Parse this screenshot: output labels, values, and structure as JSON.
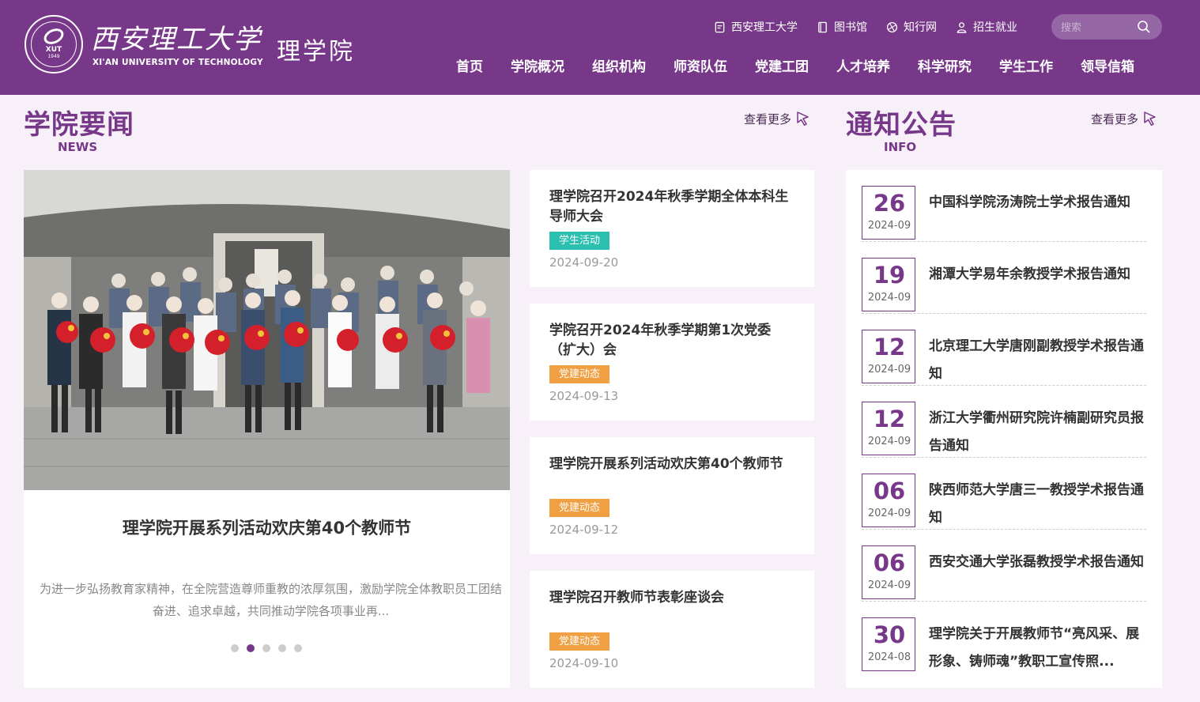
{
  "header": {
    "logo": {
      "seal_text": "XUT",
      "seal_year": "1949",
      "university_name": "西安理工大学",
      "university_en": "XI'AN UNIVERSITY OF TECHNOLOGY",
      "college_name": "理学院"
    },
    "toplinks": [
      {
        "label": "西安理工大学",
        "icon": "document-icon"
      },
      {
        "label": "图书馆",
        "icon": "book-icon"
      },
      {
        "label": "知行网",
        "icon": "globe-icon"
      },
      {
        "label": "招生就业",
        "icon": "user-icon"
      }
    ],
    "search": {
      "placeholder": "搜索"
    },
    "nav": [
      "首页",
      "学院概况",
      "组织机构",
      "师资队伍",
      "党建工团",
      "人才培养",
      "科学研究",
      "学生工作",
      "领导信箱"
    ]
  },
  "news_section": {
    "title": "学院要闻",
    "subtitle": "NEWS",
    "more_label": "查看更多"
  },
  "notice_section": {
    "title": "通知公告",
    "subtitle": "INFO",
    "more_label": "查看更多"
  },
  "featured": {
    "title": "理学院开展系列活动欢庆第40个教师节",
    "summary": "为进一步弘扬教育家精神，在全院营造尊师重教的浓厚氛围，激励学院全体教职员工团结奋进、追求卓越，共同推动学院各项事业再...",
    "carousel": {
      "count": 5,
      "active": 2
    }
  },
  "news": [
    {
      "title": "理学院召开2024年秋季学期全体本科生导师大会",
      "tag": "学生活动",
      "date": "2024-09-20"
    },
    {
      "title": "学院召开2024年秋季学期第1次党委（扩大）会",
      "tag": "党建动态",
      "date": "2024-09-13"
    },
    {
      "title": "理学院开展系列活动欢庆第40个教师节",
      "tag": "党建动态",
      "date": "2024-09-12"
    },
    {
      "title": "理学院召开教师节表彰座谈会",
      "tag": "党建动态",
      "date": "2024-09-10"
    }
  ],
  "notices": [
    {
      "day": "26",
      "ym": "2024-09",
      "title": "中国科学院汤涛院士学术报告通知"
    },
    {
      "day": "19",
      "ym": "2024-09",
      "title": "湘潭大学易年余教授学术报告通知"
    },
    {
      "day": "12",
      "ym": "2024-09",
      "title": "北京理工大学唐刚副教授学术报告通知"
    },
    {
      "day": "12",
      "ym": "2024-09",
      "title": "浙江大学衢州研究院许楠副研究员报告通知"
    },
    {
      "day": "06",
      "ym": "2024-09",
      "title": "陕西师范大学唐三一教授学术报告通知"
    },
    {
      "day": "06",
      "ym": "2024-09",
      "title": "西安交通大学张磊教授学术报告通知"
    },
    {
      "day": "30",
      "ym": "2024-08",
      "title": "理学院关于开展教师节“亮风采、展形象、铸师魂”教职工宣传照..."
    }
  ],
  "colors": {
    "brand": "#773889",
    "tag_student": "#2bbfb0",
    "tag_party": "#f0a042",
    "page_bg": "#f8f0f8"
  }
}
